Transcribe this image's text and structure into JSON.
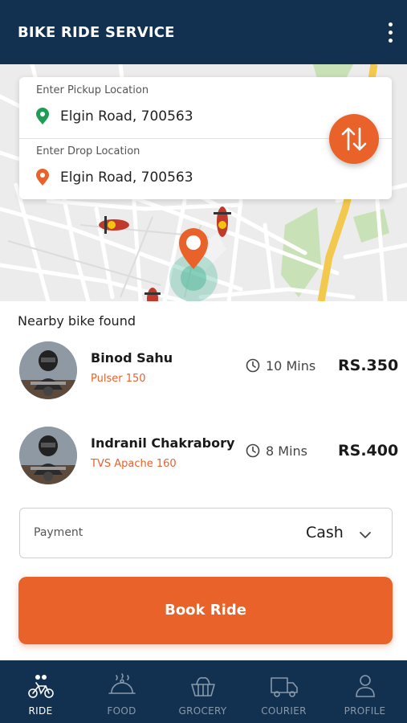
{
  "header": {
    "title": "BIKE RIDE SERVICE"
  },
  "locations": {
    "pickup": {
      "label": "Enter Pickup Location",
      "value": "Elgin Road, 700563"
    },
    "drop": {
      "label": "Enter Drop Location",
      "value": "Elgin Road, 700563"
    }
  },
  "nearby": {
    "title": "Nearby bike found",
    "riders": [
      {
        "name": "Binod Sahu",
        "bike": "Pulser 150",
        "time": "10 Mins",
        "price": "RS.350"
      },
      {
        "name": "Indranil Chakrabory",
        "bike": "TVS Apache 160",
        "time": "8 Mins",
        "price": "RS.400"
      }
    ]
  },
  "payment": {
    "label": "Payment",
    "value": "Cash"
  },
  "book_button": "Book Ride",
  "nav": [
    {
      "label": "RIDE",
      "icon": "bike-ride-icon",
      "active": true
    },
    {
      "label": "FOOD",
      "icon": "food-cloche-icon",
      "active": false
    },
    {
      "label": "GROCERY",
      "icon": "grocery-basket-icon",
      "active": false
    },
    {
      "label": "COURIER",
      "icon": "courier-truck-icon",
      "active": false
    },
    {
      "label": "PROFILE",
      "icon": "profile-icon",
      "active": false
    }
  ],
  "colors": {
    "header": "#12304f",
    "accent": "#e8622a",
    "pickup_pin": "#1f9d55",
    "map_road": "#f2c94c",
    "map_park": "#c8e1b6"
  }
}
